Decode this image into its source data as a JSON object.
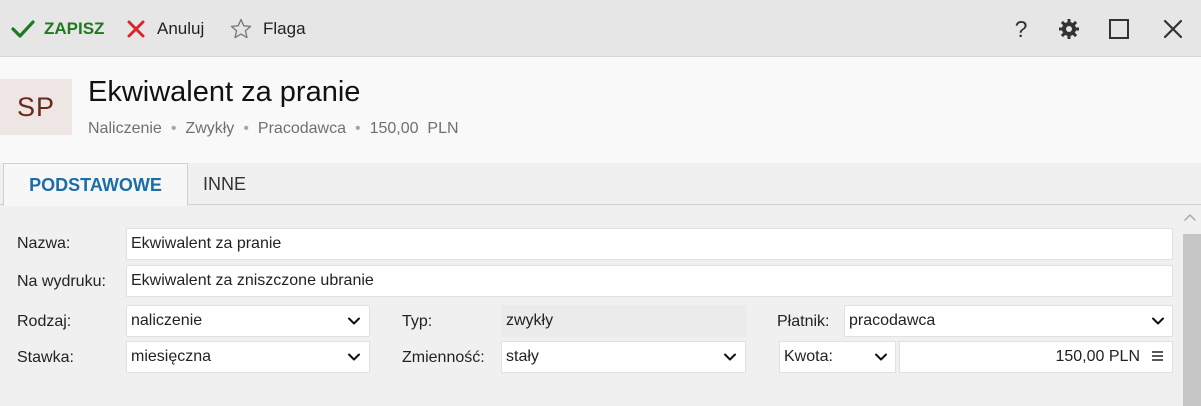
{
  "toolbar": {
    "save_label": "ZAPISZ",
    "cancel_label": "Anuluj",
    "flag_label": "Flaga",
    "help_label": "?"
  },
  "header": {
    "avatar_text": "SP",
    "title": "Ekwiwalent za pranie",
    "subtitle": [
      "Naliczenie",
      "Zwykły",
      "Pracodawca",
      "150,00  PLN"
    ]
  },
  "tabs": [
    {
      "label": "PODSTAWOWE",
      "active": true
    },
    {
      "label": "INNE",
      "active": false
    }
  ],
  "form": {
    "nazwa": {
      "label": "Nazwa:",
      "value": "Ekwiwalent za pranie"
    },
    "na_wydruku": {
      "label": "Na wydruku:",
      "value": "Ekwiwalent za zniszczone ubranie"
    },
    "rodzaj": {
      "label": "Rodzaj:",
      "value": "naliczenie"
    },
    "typ": {
      "label": "Typ:",
      "value": "zwykły"
    },
    "platnik": {
      "label": "Płatnik:",
      "value": "pracodawca"
    },
    "stawka": {
      "label": "Stawka:",
      "value": "miesięczna"
    },
    "zmiennosc": {
      "label": "Zmienność:",
      "value": "stały"
    },
    "kwota": {
      "label": "Kwota:",
      "value": "150,00 PLN"
    }
  },
  "colors": {
    "save_green": "#1f7a1f",
    "cancel_red": "#d9262c",
    "tab_active_blue": "#1a6ea8",
    "avatar_text": "#6a2a1a",
    "avatar_bg": "#ede6e4"
  },
  "icons": {
    "save": "check-icon",
    "cancel": "x-icon",
    "flag": "star-outline-icon",
    "settings": "gear-icon",
    "maximize": "square-icon",
    "close": "close-icon"
  }
}
